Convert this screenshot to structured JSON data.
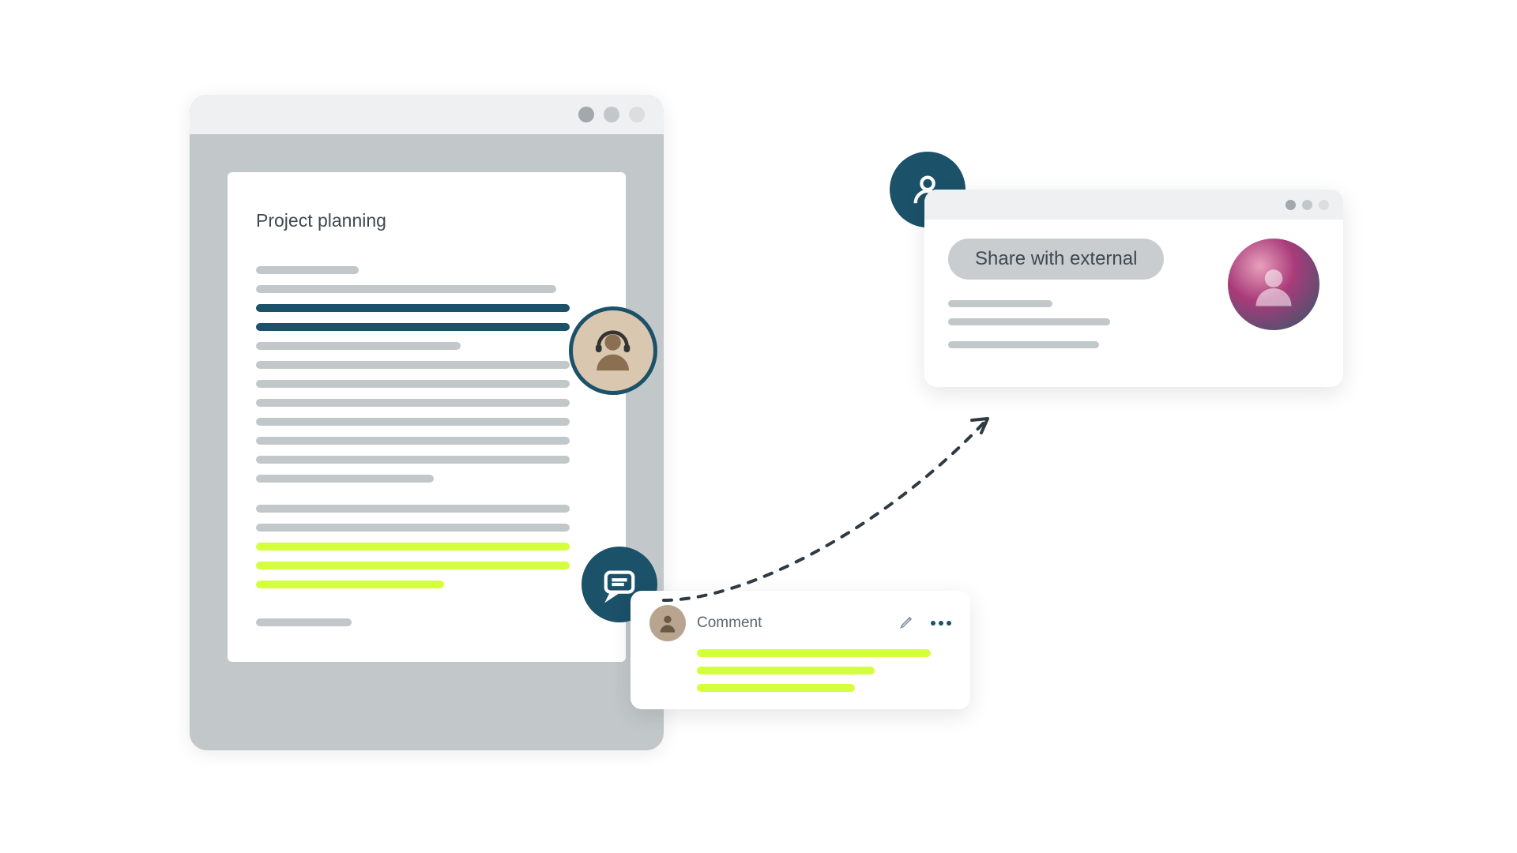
{
  "document": {
    "title": "Project planning"
  },
  "comment": {
    "heading": "Comment"
  },
  "share": {
    "button_label": "Share with external"
  },
  "colors": {
    "teal": "#1b5169",
    "lime": "#d4ff3c",
    "gray": "#c2c7ca",
    "titlebar": "#eef0f1"
  },
  "window_dots": {
    "dark": "#a2a8ab",
    "mid": "#c2c7ca",
    "light": "#dadedf"
  }
}
